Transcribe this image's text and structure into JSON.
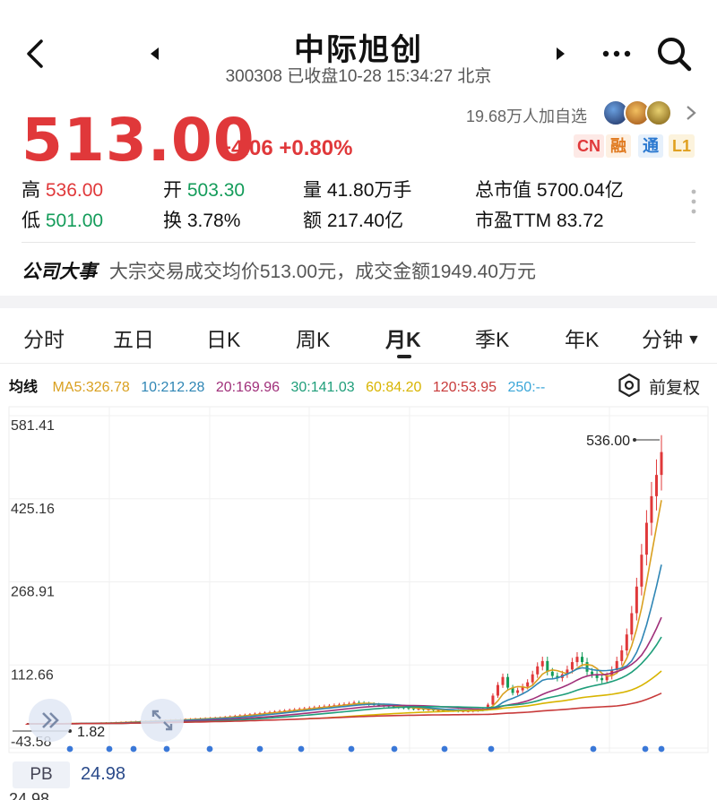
{
  "header": {
    "title": "中际旭创",
    "subtitle": "300308 已收盘10-28 15:34:27 北京"
  },
  "quote": {
    "price": "513.00",
    "change": "+4.06 +0.80%",
    "watchers": "19.68万人加自选",
    "badges": [
      "CN",
      "融",
      "通",
      "L1"
    ]
  },
  "stats": [
    {
      "label": "高",
      "value": "536.00",
      "tone": "red"
    },
    {
      "label": "开",
      "value": "503.30",
      "tone": "green"
    },
    {
      "label": "量",
      "value": "41.80万手",
      "tone": "dark"
    },
    {
      "label": "总市值",
      "value": "5700.04亿",
      "tone": "dark"
    },
    {
      "label": "低",
      "value": "501.00",
      "tone": "green"
    },
    {
      "label": "换",
      "value": "3.78%",
      "tone": "dark"
    },
    {
      "label": "额",
      "value": "217.40亿",
      "tone": "dark"
    },
    {
      "label": "市盈TTM",
      "value": "83.72",
      "tone": "dark"
    }
  ],
  "event": {
    "tag": "公司大事",
    "text": "大宗交易成交均价513.00元，成交金额1949.40万元"
  },
  "tabs": [
    "分时",
    "五日",
    "日K",
    "周K",
    "月K",
    "季K",
    "年K",
    "分钟"
  ],
  "active_tab": "月K",
  "ma_legend": {
    "label": "均线",
    "items": [
      {
        "text": "MA5:326.78",
        "color": "#d9a020"
      },
      {
        "text": "10:212.28",
        "color": "#2f86b5"
      },
      {
        "text": "20:169.96",
        "color": "#a0307a"
      },
      {
        "text": "30:141.03",
        "color": "#1f9e7a"
      },
      {
        "text": "60:84.20",
        "color": "#d8b400"
      },
      {
        "text": "120:53.95",
        "color": "#c83a3a"
      },
      {
        "text": "250:--",
        "color": "#3aa6d8"
      }
    ],
    "restore": "前复权"
  },
  "colors": {
    "up": "#e0383a",
    "down": "#149c5a",
    "accent": "#2a4a8a"
  },
  "chart_data": {
    "type": "candlestick",
    "y_ticks": [
      "581.41",
      "425.16",
      "268.91",
      "112.66",
      "-43.58"
    ],
    "ylim": [
      -43.58,
      581.41
    ],
    "annotations": [
      {
        "text": "536.00",
        "value": 536.0
      },
      {
        "text": "1.82",
        "value": 1.82
      }
    ],
    "close_series": [
      1.82,
      1.9,
      2.0,
      2.1,
      2.2,
      2.3,
      2.4,
      2.5,
      2.6,
      2.7,
      2.8,
      2.9,
      3.0,
      3.1,
      3.3,
      3.6,
      3.9,
      4.2,
      4.6,
      5.0,
      5.5,
      6.0,
      6.4,
      6.8,
      7.2,
      7.6,
      8.0,
      8.4,
      8.8,
      9.2,
      9.6,
      10,
      10.5,
      11,
      11.5,
      12,
      12.5,
      13,
      13.5,
      14,
      15,
      16,
      17,
      18,
      19,
      20,
      21,
      22,
      23,
      24,
      25,
      26,
      27,
      28,
      29,
      30,
      31,
      32,
      33,
      34,
      35,
      36,
      37,
      38,
      39,
      40,
      42,
      41,
      40,
      39,
      38,
      37,
      36,
      35,
      34,
      33,
      32,
      31,
      30,
      30,
      29,
      29,
      28,
      28,
      27,
      27,
      27,
      26,
      26,
      26,
      27,
      28,
      30,
      38,
      55,
      75,
      90,
      70,
      60,
      65,
      72,
      80,
      95,
      110,
      120,
      100,
      92,
      88,
      95,
      104,
      118,
      128,
      118,
      100,
      95,
      88,
      84,
      92,
      103,
      120,
      140,
      170,
      210,
      260,
      320,
      380,
      430,
      470,
      513
    ]
  },
  "pb": {
    "label": "PB",
    "value": "24.98",
    "next_axis": "24.98"
  }
}
